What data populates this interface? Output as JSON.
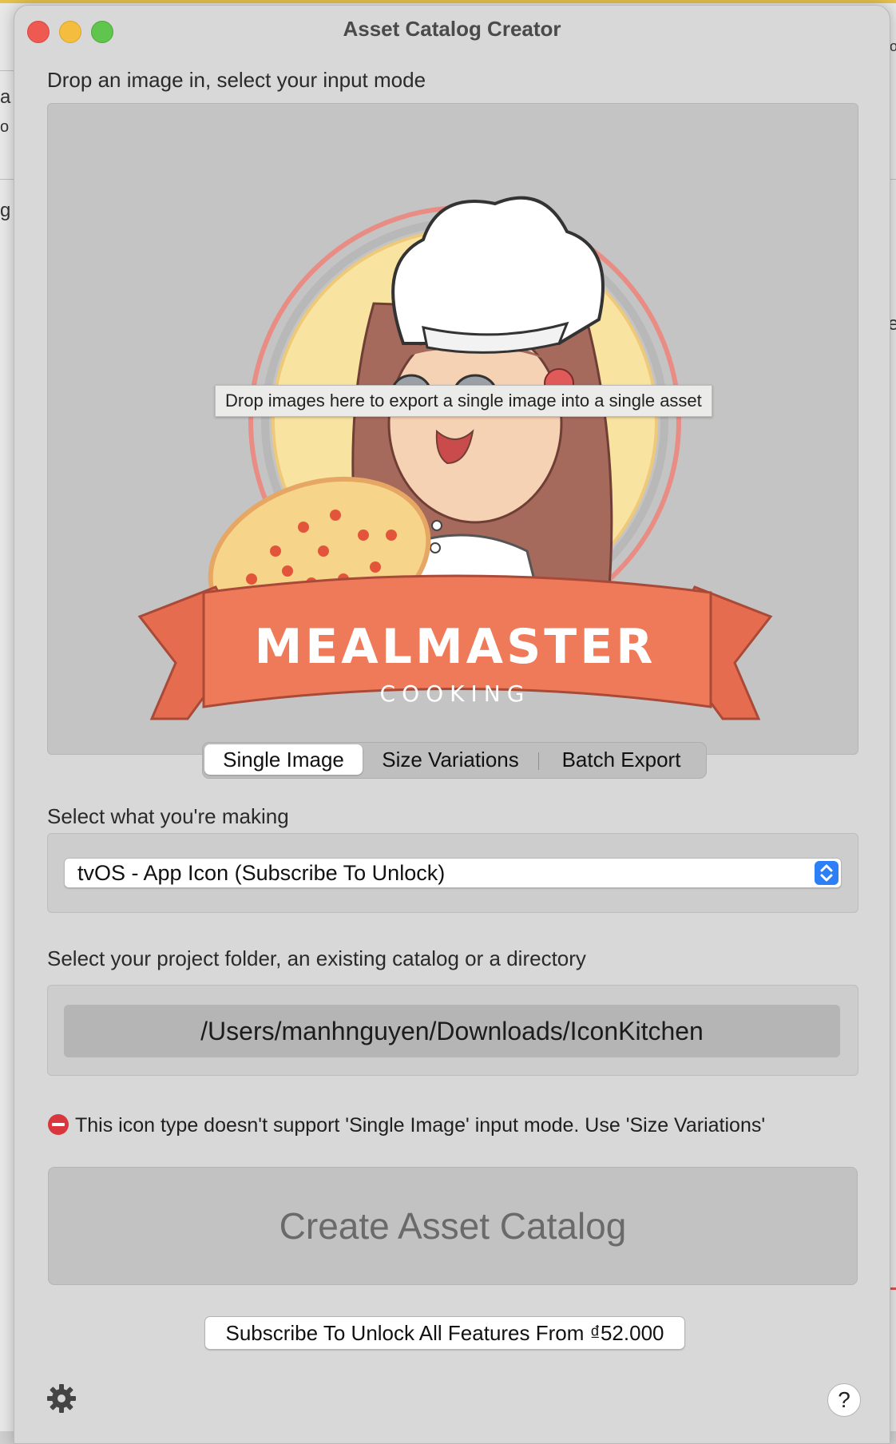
{
  "window": {
    "title": "Asset Catalog Creator"
  },
  "background_fragments": [
    "a",
    "o",
    "g V",
    "e",
    "o"
  ],
  "drop": {
    "label": "Drop an image in, select your input mode",
    "tooltip": "Drop images here to export a single image into a single asset",
    "logo": {
      "brand": "MEALMASTER",
      "sub": "COOKING"
    }
  },
  "input_modes": [
    "Single Image",
    "Size Variations",
    "Batch Export"
  ],
  "input_mode_selected": "Single Image",
  "making": {
    "label": "Select what you're making",
    "selected": "tvOS - App Icon (Subscribe To Unlock)"
  },
  "project": {
    "label": "Select your project folder, an existing catalog or a directory",
    "path": "/Users/manhnguyen/Downloads/IconKitchen"
  },
  "warning": "This icon type doesn't support 'Single Image' input mode. Use 'Size Variations'",
  "create_button": "Create Asset Catalog",
  "subscribe_button": "Subscribe To Unlock All Features From ₫52.000",
  "help_button": "?",
  "colors": {
    "accent": "#2d7ff5",
    "ribbon": "#ef7a5a",
    "sun": "#f9e3a0",
    "ring": "#e88c84"
  }
}
